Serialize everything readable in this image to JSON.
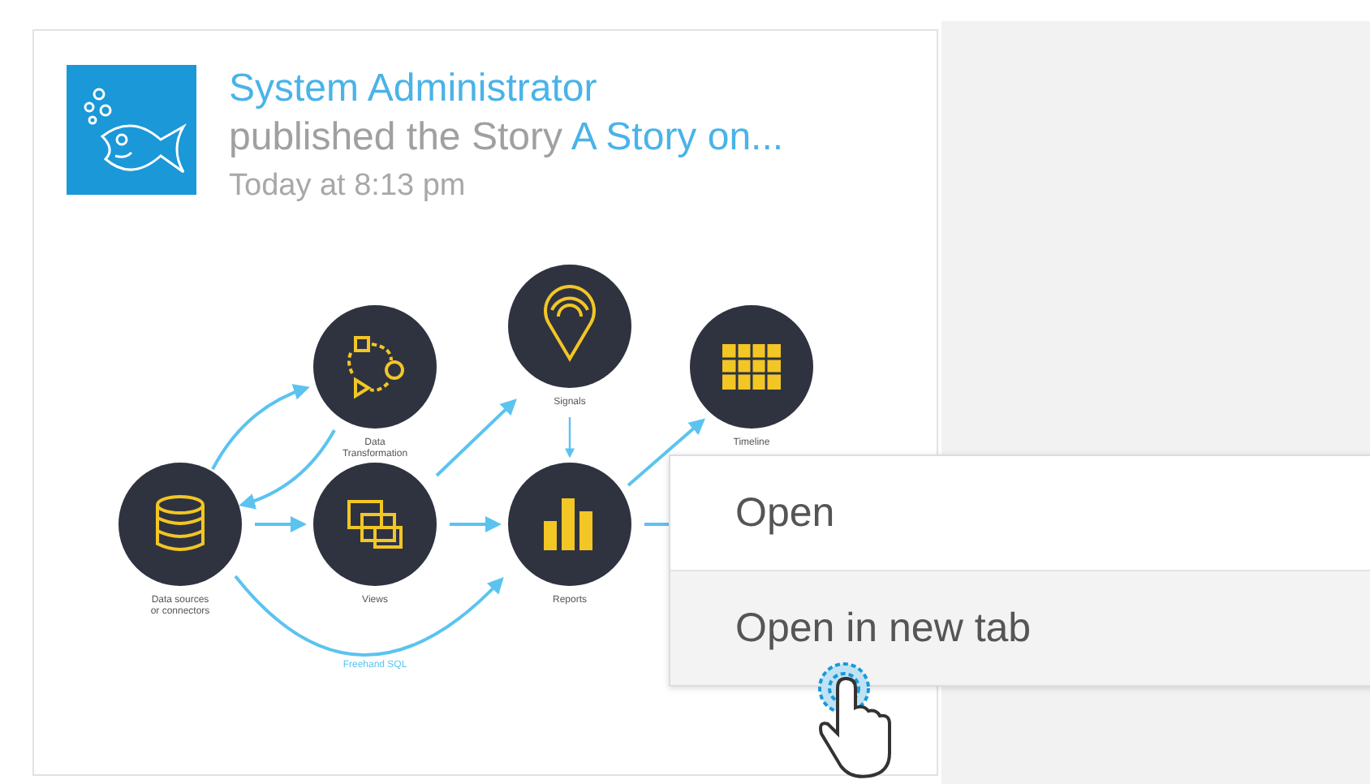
{
  "post": {
    "author": "System Administrator",
    "action": "published the Story",
    "story_link": "A Story on...",
    "time": "Today at 8:13 pm"
  },
  "diagram": {
    "nodes": [
      {
        "kind": "database",
        "label": [
          "Data sources",
          "or connectors"
        ]
      },
      {
        "kind": "transform",
        "label": [
          "Data",
          "Transformation"
        ]
      },
      {
        "kind": "views",
        "label": [
          "Views"
        ]
      },
      {
        "kind": "signals",
        "label": [
          "Signals"
        ]
      },
      {
        "kind": "reports",
        "label": [
          "Reports"
        ]
      },
      {
        "kind": "timeline",
        "label": [
          "Timeline"
        ]
      }
    ],
    "edge_label": "Freehand SQL"
  },
  "context_menu": [
    {
      "label": "Open",
      "selected": false
    },
    {
      "label": "Open in new tab",
      "selected": true
    }
  ]
}
